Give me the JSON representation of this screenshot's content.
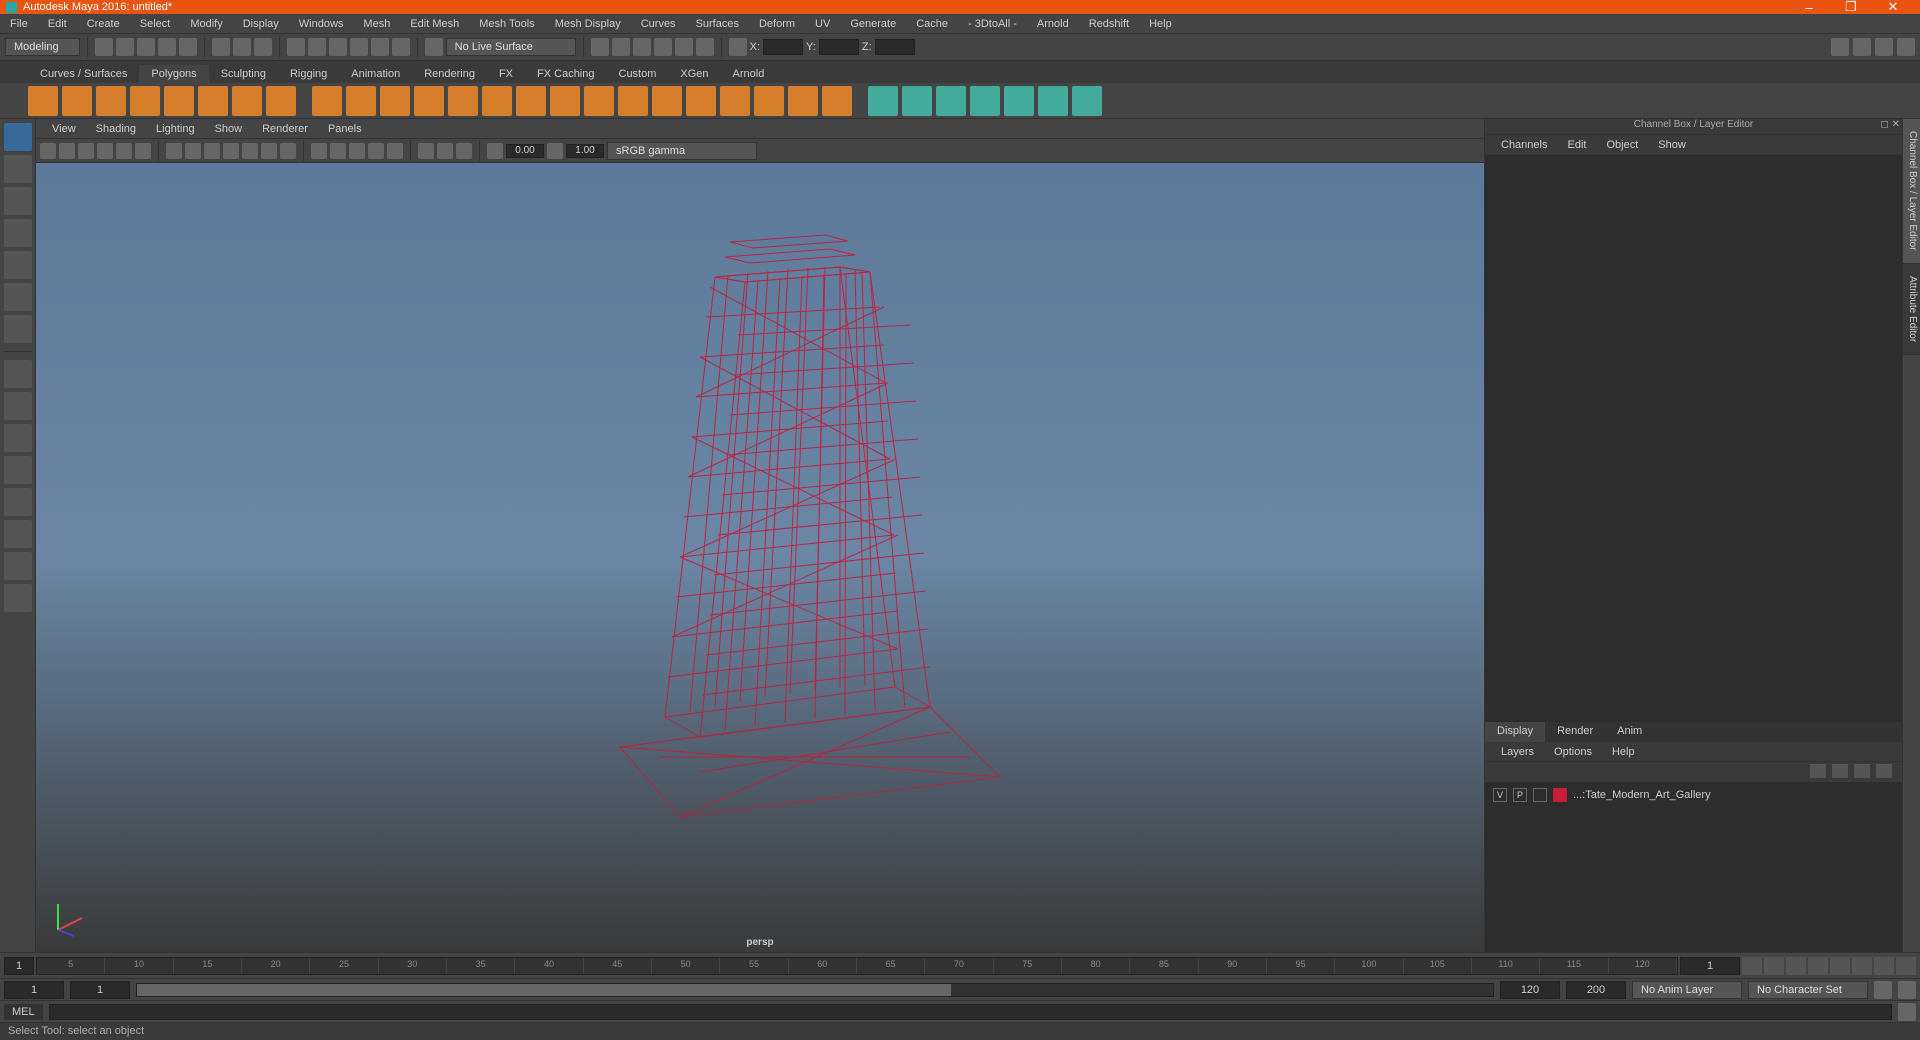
{
  "title": "Autodesk Maya 2016: untitled*",
  "menus": [
    "File",
    "Edit",
    "Create",
    "Select",
    "Modify",
    "Display",
    "Windows",
    "Mesh",
    "Edit Mesh",
    "Mesh Tools",
    "Mesh Display",
    "Curves",
    "Surfaces",
    "Deform",
    "UV",
    "Generate",
    "Cache",
    "- 3DtoAll -",
    "Arnold",
    "Redshift",
    "Help"
  ],
  "workspace": "Modeling",
  "live_surface": "No Live Surface",
  "coord": {
    "x": "X:",
    "y": "Y:",
    "z": "Z:"
  },
  "shelf_tabs": [
    "Curves / Surfaces",
    "Polygons",
    "Sculpting",
    "Rigging",
    "Animation",
    "Rendering",
    "FX",
    "FX Caching",
    "Custom",
    "XGen",
    "Arnold"
  ],
  "shelf_active": 1,
  "panel_menus": [
    "View",
    "Shading",
    "Lighting",
    "Show",
    "Renderer",
    "Panels"
  ],
  "viewport_nums": {
    "a": "0.00",
    "b": "1.00"
  },
  "color_space": "sRGB gamma",
  "camera": "persp",
  "channel_title": "Channel Box / Layer Editor",
  "channel_menus": [
    "Channels",
    "Edit",
    "Object",
    "Show"
  ],
  "layer_tabs": [
    "Display",
    "Render",
    "Anim"
  ],
  "layer_tab_active": 0,
  "layer_menus": [
    "Layers",
    "Options",
    "Help"
  ],
  "layer": {
    "v": "V",
    "p": "P",
    "name": "...:Tate_Modern_Art_Gallery"
  },
  "side_tabs": [
    "Channel Box / Layer Editor",
    "Attribute Editor"
  ],
  "timeline": {
    "start_disp": "1",
    "current": "1",
    "range_start": "1",
    "slider_start": "1",
    "slider_end": "120",
    "range_end_a": "120",
    "range_end_b": "200"
  },
  "timeline_ticks": [
    "5",
    "10",
    "15",
    "20",
    "25",
    "30",
    "35",
    "40",
    "45",
    "50",
    "55",
    "60",
    "65",
    "70",
    "75",
    "80",
    "85",
    "90",
    "95",
    "100",
    "105",
    "110",
    "115",
    "120"
  ],
  "anim_layer": "No Anim Layer",
  "char_set": "No Character Set",
  "cmd_label": "MEL",
  "helpline": "Select Tool: select an object"
}
